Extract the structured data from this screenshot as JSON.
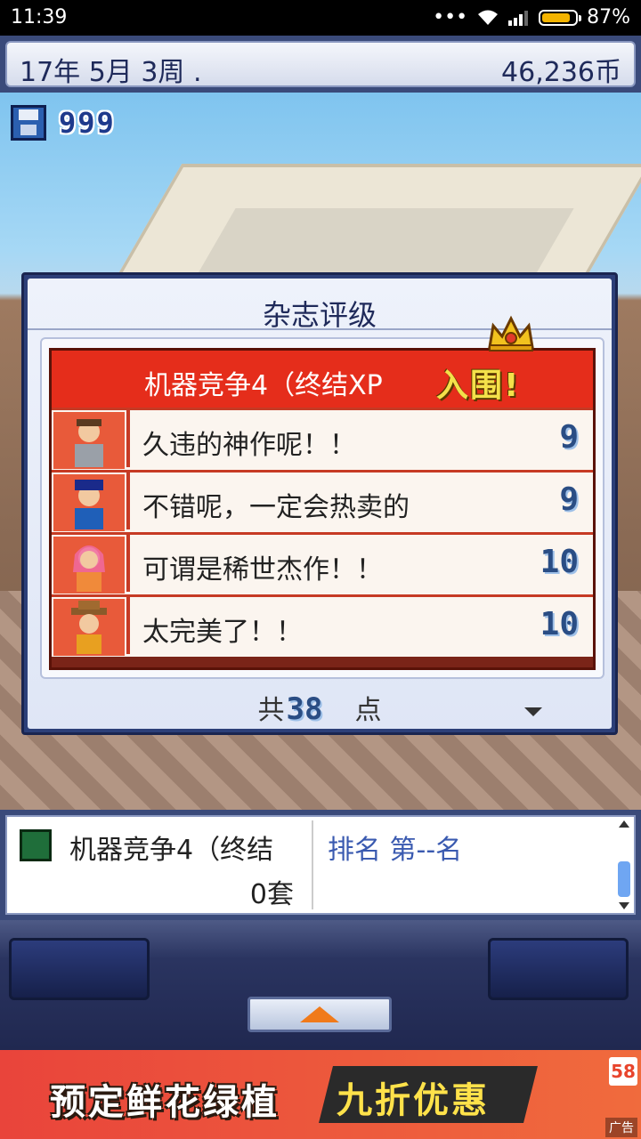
{
  "status_bar": {
    "time": "11:39",
    "signal_text": "•••",
    "battery_percent": "87%",
    "battery_level": 0.87
  },
  "header": {
    "date": "17年 5月 3周 .",
    "money": "46,236币"
  },
  "scene": {
    "save_count": "999"
  },
  "dialog": {
    "title": "杂志评级",
    "game_name": "机器竞争4（终结XP",
    "nominated": "入围!",
    "reviews": [
      {
        "comment": "久违的神作呢！！",
        "score": "9",
        "reviewer_icon": "reviewer-businessman-icon"
      },
      {
        "comment": "不错呢，一定会热卖的",
        "score": "9",
        "reviewer_icon": "reviewer-police-icon"
      },
      {
        "comment": "可谓是稀世杰作！！",
        "score": "10",
        "reviewer_icon": "reviewer-girl-icon"
      },
      {
        "comment": "太完美了！！",
        "score": "10",
        "reviewer_icon": "reviewer-cowboy-icon"
      }
    ],
    "total_prefix": "共",
    "total_points": "38",
    "total_suffix": "点"
  },
  "info_panel": {
    "title": "机器竞争4（终结",
    "copies": "0套",
    "rank": "排名 第--名"
  },
  "ad": {
    "left_text": "预定鲜花绿植",
    "right_text": "九折优惠",
    "logo": "58",
    "label": "广告"
  },
  "colors": {
    "dialog_header_red": "#e52d1b",
    "score_blue": "#2a4d84",
    "nominated_yellow": "#f4e14a"
  }
}
